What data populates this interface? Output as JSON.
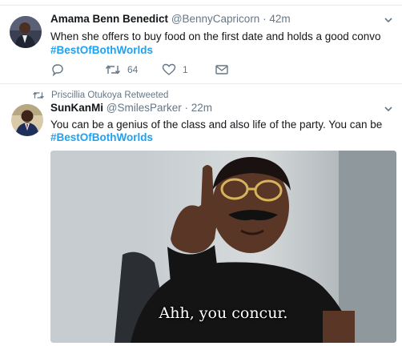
{
  "colors": {
    "accent": "#1da1f2",
    "secondary_text": "#657786",
    "text": "#14171a",
    "divider": "#e6ecf0"
  },
  "tweets": [
    {
      "name": "Amama Benn Benedict",
      "handle": "@BennyCapricorn",
      "time": "· 42m",
      "text": "When she offers to buy food on the first date and holds a good convo",
      "hashtag": "#BestOfBothWorlds",
      "actions": {
        "reply": "",
        "retweet": "64",
        "like": "1",
        "dm": ""
      },
      "icons": [
        "avatar",
        "chevron-down-icon",
        "reply-icon",
        "retweet-icon",
        "heart-icon",
        "envelope-icon"
      ]
    },
    {
      "retweeted_by": "Priscillia Otukoya Retweeted",
      "name": "SunKanMi",
      "handle": "@SmilesParker",
      "time": "· 22m",
      "text": "You can be a genius of the class and also life of the party. You can be",
      "hashtag": "#BestOfBothWorlds",
      "media_caption": "Ahh, you concur.",
      "icons": [
        "retweet-icon",
        "avatar",
        "chevron-down-icon"
      ]
    }
  ]
}
